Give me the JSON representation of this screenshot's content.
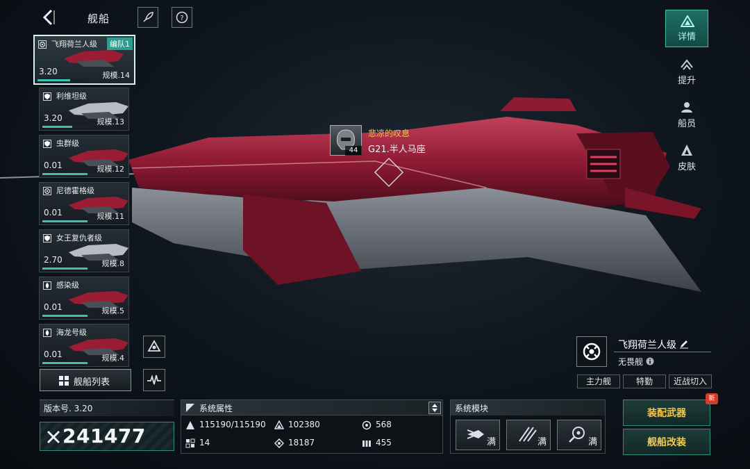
{
  "header": {
    "title": "舰船"
  },
  "ship_list": [
    {
      "name": "飞翔荷兰人级",
      "fleet": "编队1",
      "version": "3.20",
      "scale": "规模.14",
      "progress": 0.65,
      "active": true,
      "icon": "crosshair-icon"
    },
    {
      "name": "利维坦级",
      "version": "3.20",
      "scale": "规模.13",
      "progress": 0.6,
      "icon": "shield-icon"
    },
    {
      "name": "虫群级",
      "version": "0.01",
      "scale": "规模.12",
      "progress": 0.9,
      "icon": "shield-icon"
    },
    {
      "name": "尼德霍格级",
      "version": "0.01",
      "scale": "规模.11",
      "progress": 0.9,
      "icon": "crosshair-icon"
    },
    {
      "name": "女王复仇者级",
      "version": "2.70",
      "scale": "规模.8",
      "progress": 0.9,
      "icon": "shield-icon"
    },
    {
      "name": "感染级",
      "version": "0.01",
      "scale": "规模.5",
      "progress": 0.9,
      "icon": "flame-icon"
    },
    {
      "name": "海龙号级",
      "version": "0.01",
      "scale": "规模.4",
      "progress": 0.9,
      "icon": "flame-icon"
    }
  ],
  "side_tabs": [
    {
      "label": "详情",
      "active": true
    },
    {
      "label": "提升"
    },
    {
      "label": "船员"
    },
    {
      "label": "皮肤"
    }
  ],
  "pilot": {
    "name": "悲凉的叹息",
    "unit": "G21.半人马座",
    "level": "44"
  },
  "ship_info": {
    "name": "飞翔荷兰人级",
    "class": "无畏舰",
    "roles": [
      "主力舰",
      "特勤",
      "近战切入"
    ]
  },
  "buttons": {
    "ship_list": "舰船列表",
    "equip_weapons": "装配武器",
    "refit": "舰船改装",
    "new_badge": "新"
  },
  "version": {
    "label": "版本号. 3.20"
  },
  "power": "241477",
  "stats": {
    "title": "系统属性",
    "hp": "115190/115190",
    "armor": "102380",
    "speed": "568",
    "shield": "14",
    "energy": "18187",
    "cargo": "455"
  },
  "modules": {
    "title": "系统模块",
    "slots": [
      "满",
      "满",
      "满"
    ]
  },
  "colors": {
    "accent": "#3fc0b0",
    "gold": "#f3c94a",
    "ship_red": "#8e1a33"
  }
}
